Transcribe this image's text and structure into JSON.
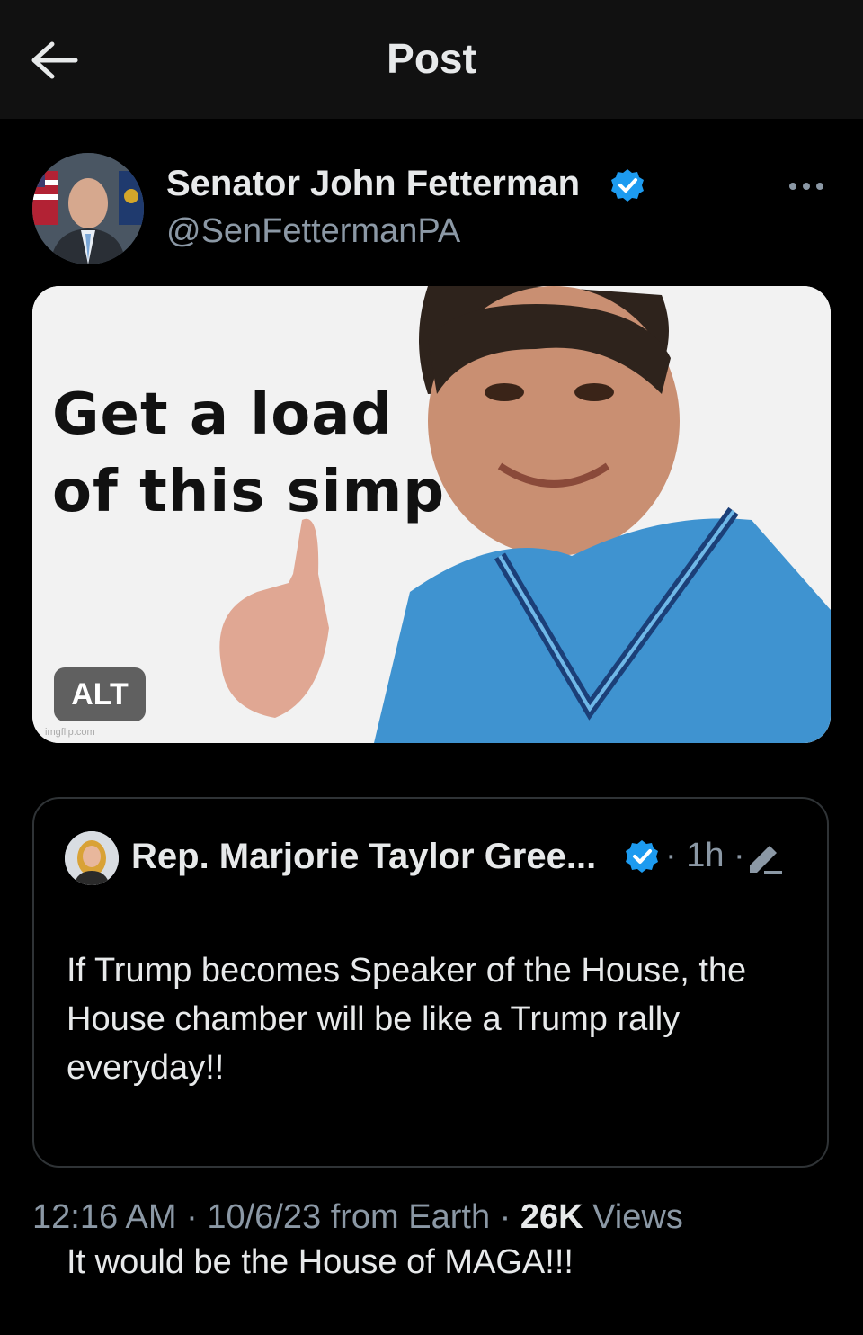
{
  "header": {
    "title": "Post",
    "back_icon": "arrow-left-icon"
  },
  "post": {
    "author_name": "Senator John Fetterman",
    "author_handle": "@SenFettermanPA",
    "meme_line1": "Get a load",
    "meme_line2": "of this simp",
    "alt_label": "ALT",
    "watermark": "imgflip.com"
  },
  "quoted": {
    "author_name": "Rep. Marjorie Taylor Gree...",
    "time": "· 1h ·",
    "text_p1": "If Trump becomes Speaker of the House, the House chamber will be like a Trump rally everyday!!",
    "text_p2": "It would be the House of MAGA!!!"
  },
  "meta": {
    "time": "12:16 AM",
    "sep1": " · ",
    "date": "10/6/23",
    "source": " from Earth",
    "sep2": " · ",
    "views_count": "26K",
    "views_label": " Views"
  },
  "colors": {
    "verified": "#1d9bf0",
    "muted": "#8b98a5",
    "background": "#000000"
  }
}
